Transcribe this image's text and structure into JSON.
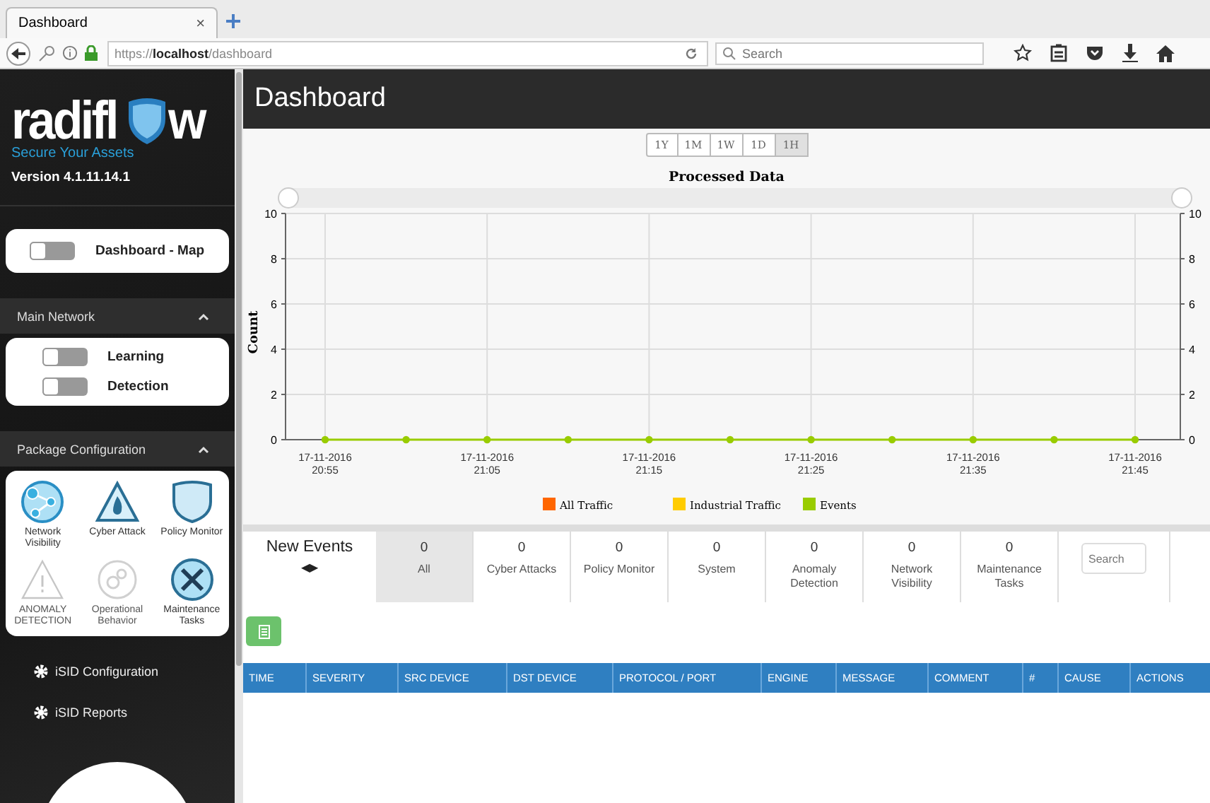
{
  "browser": {
    "tab": {
      "title": "Dashboard",
      "close": "×"
    },
    "url": "https://**localhost**/dashboard",
    "search": {
      "placeholder": "Search"
    }
  },
  "sidebar": {
    "logo": {
      "before": "radifl",
      "after": "w"
    },
    "tagline": "Secure Your Assets",
    "version": "Version 4.1.11.14.1",
    "map_toggle": {
      "label": "Dashboard - Map",
      "on": false
    },
    "sections": [
      {
        "title": "Main Network",
        "expanded": true,
        "kind": "toggles",
        "toggles": [
          {
            "label": "Learning",
            "on": false
          },
          {
            "label": "Detection",
            "on": false
          }
        ]
      },
      {
        "title": "Package Configuration",
        "expanded": true,
        "kind": "packages",
        "packages": [
          {
            "label": "Network Visibility",
            "kind": "network",
            "enabled": true
          },
          {
            "label": "Cyber Attack",
            "kind": "attack",
            "enabled": true
          },
          {
            "label": "Policy Monitor",
            "kind": "shield",
            "enabled": true
          },
          {
            "label": "ANOMALY DETECTION",
            "kind": "anomaly",
            "enabled": false
          },
          {
            "label": "Operational Behavior",
            "kind": "gears",
            "enabled": false
          },
          {
            "label": "Maintenance Tasks",
            "kind": "tools",
            "enabled": true
          }
        ]
      }
    ],
    "links": [
      {
        "label": "iSID Configuration"
      },
      {
        "label": "iSID Reports"
      }
    ]
  },
  "page": {
    "title": "Dashboard"
  },
  "ranges": [
    {
      "label": "1Y",
      "selected": false
    },
    {
      "label": "1M",
      "selected": false
    },
    {
      "label": "1W",
      "selected": false
    },
    {
      "label": "1D",
      "selected": false
    },
    {
      "label": "1H",
      "selected": true
    }
  ],
  "chart_data": {
    "type": "line",
    "title": "Processed Data",
    "ylabel": "Count",
    "categories": [
      "17-11-2016 20:55",
      null,
      "17-11-2016 21:05",
      null,
      "17-11-2016 21:15",
      null,
      "17-11-2016 21:25",
      null,
      "17-11-2016 21:35",
      null,
      "17-11-2016 21:45"
    ],
    "ylim": [
      0,
      10
    ],
    "yticks": [
      0,
      2,
      4,
      6,
      8,
      10
    ],
    "y2lim": [
      0,
      10
    ],
    "y2ticks": [
      0,
      2,
      4,
      6,
      8,
      10
    ],
    "grid": true,
    "legend": true,
    "series": [
      {
        "name": "All Traffic",
        "color": "#ff6600",
        "marker": "circle",
        "values": [
          null,
          null,
          null,
          null,
          null,
          null,
          null,
          null,
          null,
          null,
          null
        ]
      },
      {
        "name": "Industrial Traffic",
        "color": "#ffcc00",
        "marker": "circle",
        "values": [
          null,
          null,
          null,
          null,
          null,
          null,
          null,
          null,
          null,
          null,
          null
        ]
      },
      {
        "name": "Events",
        "color": "#99cc00",
        "marker": "circle",
        "values": [
          0,
          0,
          0,
          0,
          0,
          0,
          0,
          0,
          0,
          0,
          0
        ]
      }
    ]
  },
  "events": {
    "title": "New Events",
    "prev": "◀",
    "next": "▶",
    "tabs": [
      {
        "count": "0",
        "label": "All",
        "selected": true
      },
      {
        "count": "0",
        "label": "Cyber Attacks",
        "selected": false
      },
      {
        "count": "0",
        "label": "Policy Monitor",
        "selected": false
      },
      {
        "count": "0",
        "label": "System",
        "selected": false
      },
      {
        "count": "0",
        "label": "Anomaly Detection",
        "selected": false
      },
      {
        "count": "0",
        "label": "Network Visibility",
        "selected": false
      },
      {
        "count": "0",
        "label": "Maintenance Tasks",
        "selected": false
      }
    ],
    "search": {
      "placeholder": "Search"
    }
  },
  "table": {
    "columns": [
      "TIME",
      "SEVERITY",
      "SRC DEVICE",
      "DST DEVICE",
      "PROTOCOL / PORT",
      "ENGINE",
      "MESSAGE",
      "COMMENT",
      "#",
      "CAUSE",
      "ACTIONS"
    ]
  }
}
